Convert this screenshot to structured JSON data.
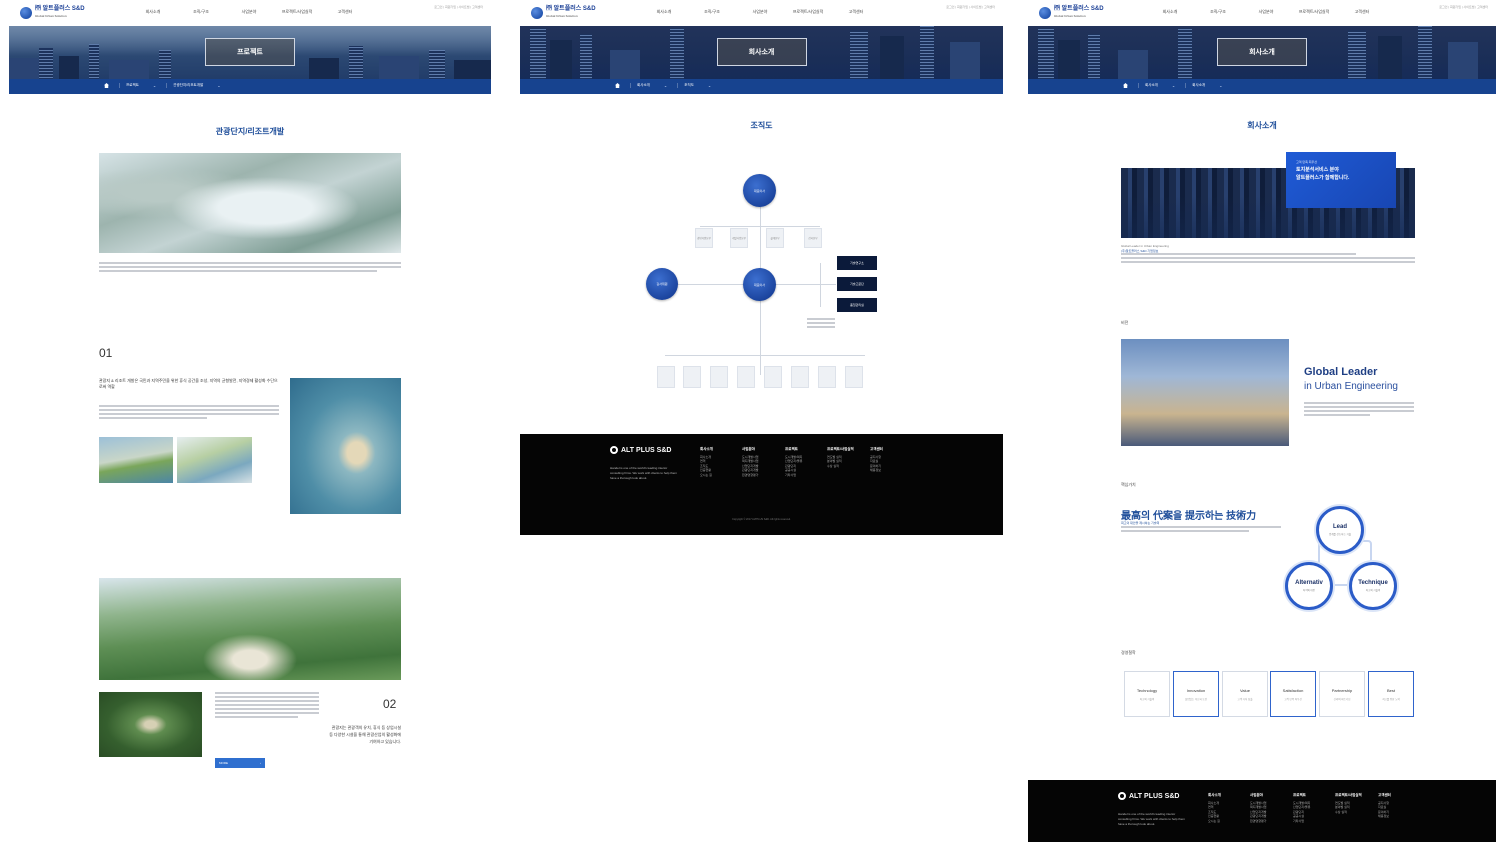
{
  "brand": {
    "name": "㈜ 알트플러스 S&D",
    "sub": "Global Urban Solution"
  },
  "nav": {
    "items": [
      "회사소개",
      "조직/구조",
      "사업분야",
      "프로젝트/사업실적",
      "고객센터"
    ],
    "util": "로그인 | 회원가입 | 사이트맵 | 고객센터"
  },
  "panel1": {
    "hero_title": "프로젝트",
    "crumb": {
      "home": "HOME",
      "level1": "프로젝트",
      "level2": "관광단지/리조트개발"
    },
    "section_title": "관광단지/리조트개발",
    "num1": "01",
    "heading1": "관광지 & 리조트 개발은 국민과 지역주민을 위한 휴식 공간을 조성, 지역의 균형발전, 지역경제 활성화 수단으로써 역할",
    "num2": "02",
    "heading2": "관광지는 관광객의 유치, 휴식 등 상업시설 등 다양한 시설을 통해 관광산업의 활성화에 기여하고 있습니다.",
    "button": "MORE"
  },
  "panel2": {
    "hero_title": "회사소개",
    "crumb": {
      "home": "HOME",
      "level1": "회사소개",
      "level2": "조직도"
    },
    "section_title": "조직도",
    "org": {
      "top": "대표이사",
      "left": "감사위원",
      "center": "대표이사",
      "row": [
        "경영지원본부",
        "개발사업본부",
        "설계본부",
        "감리본부"
      ],
      "right": [
        "기술연구소",
        "기술고문단",
        "품질관리실"
      ]
    }
  },
  "panel3": {
    "hero_title": "회사소개",
    "crumb": {
      "home": "HOME",
      "level1": "회사소개",
      "level2": "회사소개"
    },
    "section_title": "회사소개",
    "quote_small": "고객 만족 최우선",
    "quote": "토지분석서비스 분야\n알트플러스가 함께합니다.",
    "intro_label": "Global Leader in Urban Engineering",
    "intro_company": "(주)알트플러스 S&D 기업정보",
    "vision_label": "비전",
    "gl_title": "Global Leader",
    "gl_sub": "in Urban Engineering",
    "core_label": "핵심가치",
    "core_title": "最高의 代案을 提示하는 技術力",
    "core_sub": "최고의 대안을 제시하는 기술력",
    "rings": [
      {
        "title": "Lead",
        "sub": "업계를 선도하는 기술"
      },
      {
        "title": "Alternativ",
        "sub": "최적의 대안"
      },
      {
        "title": "Technique",
        "sub": "최고의 기술력"
      }
    ],
    "values_label": "경영철학",
    "values": [
      {
        "title": "Technology",
        "sub": "최고의 기술력"
      },
      {
        "title": "Innovation",
        "sub": "끊임없는 혁신과 도전"
      },
      {
        "title": "Value",
        "sub": "고객 가치 창출"
      },
      {
        "title": "Satisfaction",
        "sub": "고객 만족 최우선"
      },
      {
        "title": "Partnership",
        "sub": "신뢰의 파트너십"
      },
      {
        "title": "Best",
        "sub": "최고를 향한 노력"
      }
    ]
  },
  "footer": {
    "logo": "ALT PLUS S&D",
    "desc": "Handel is one of the world's leading interior consulting firms. We work with clients to help them have a thorough look about.",
    "cols": [
      {
        "title": "회사소개",
        "items": [
          "회사소개",
          "연혁",
          "조직도",
          "인증현황",
          "오시는 길"
        ]
      },
      {
        "title": "사업분야",
        "items": [
          "도시개발사업",
          "택지개발사업",
          "산업단지개발",
          "관광단지개발",
          "환경영향평가"
        ]
      },
      {
        "title": "프로젝트",
        "items": [
          "도시개발/택지",
          "산업단지/물류",
          "관광단지",
          "공공시설",
          "기타사업"
        ]
      },
      {
        "title": "프로젝트/사업실적",
        "items": [
          "연도별 실적",
          "분야별 실적",
          "수상 실적"
        ]
      },
      {
        "title": "고객센터",
        "items": [
          "공지사항",
          "자료실",
          "문의하기",
          "채용정보"
        ]
      }
    ],
    "copyright": "Copyright © 2017 ALTPLUS S&D. All rights reserved."
  }
}
